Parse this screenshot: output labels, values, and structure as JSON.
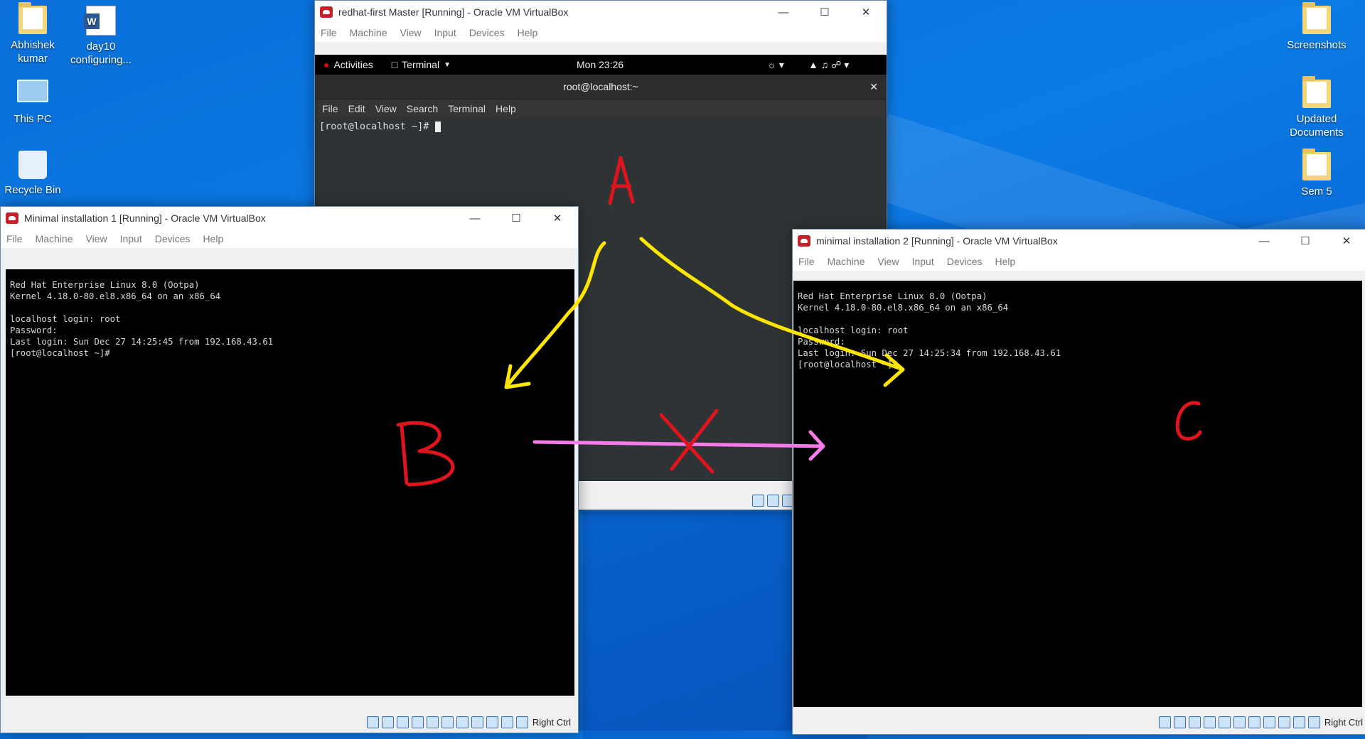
{
  "desktop": {
    "icons_left": [
      {
        "label": "Abhishek kumar",
        "type": "folder"
      },
      {
        "label": "day10 configuring...",
        "type": "word"
      },
      {
        "label": "This PC",
        "type": "pc"
      },
      {
        "label": "Recycle Bin",
        "type": "bin"
      }
    ],
    "icons_right": [
      {
        "label": "Screenshots"
      },
      {
        "label": "Updated Documents"
      },
      {
        "label": "Sem 5"
      }
    ]
  },
  "master_window": {
    "title": "redhat-first Master [Running] - Oracle VM VirtualBox",
    "menu": [
      "File",
      "Machine",
      "View",
      "Input",
      "Devices",
      "Help"
    ],
    "gnome": {
      "activities": "Activities",
      "app": "Terminal",
      "clock": "Mon 23:26"
    },
    "terminal": {
      "title": "root@localhost:~",
      "menu": [
        "File",
        "Edit",
        "View",
        "Search",
        "Terminal",
        "Help"
      ],
      "prompt": "[root@localhost ~]# "
    }
  },
  "vm1": {
    "title": "Minimal installation 1 [Running] - Oracle VM VirtualBox",
    "menu": [
      "File",
      "Machine",
      "View",
      "Input",
      "Devices",
      "Help"
    ],
    "console": [
      "Red Hat Enterprise Linux 8.0 (Ootpa)",
      "Kernel 4.18.0-80.el8.x86_64 on an x86_64",
      "",
      "localhost login: root",
      "Password:",
      "Last login: Sun Dec 27 14:25:45 from 192.168.43.61",
      "[root@localhost ~]#"
    ],
    "host_key": "Right Ctrl"
  },
  "vm2": {
    "title": "minimal installation 2 [Running] - Oracle VM VirtualBox",
    "menu": [
      "File",
      "Machine",
      "View",
      "Input",
      "Devices",
      "Help"
    ],
    "console": [
      "Red Hat Enterprise Linux 8.0 (Ootpa)",
      "Kernel 4.18.0-80.el8.x86_64 on an x86_64",
      "",
      "localhost login: root",
      "Password:",
      "Last login: Sun Dec 27 14:25:34 from 192.168.43.61",
      "[root@localhost ~]#_"
    ],
    "host_key": "Right Ctrl"
  },
  "annotations": {
    "a": "A",
    "b": "B",
    "c": "C",
    "colors": {
      "labels": "#e0141c",
      "arrows_yellow": "#ffe600",
      "arrow_pink": "#f57ce8"
    }
  }
}
